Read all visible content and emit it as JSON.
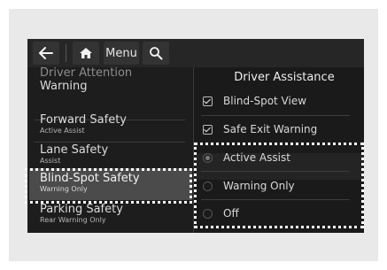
{
  "toolbar": {
    "menu_label": "Menu"
  },
  "left_menu": {
    "items": [
      {
        "title": "Driver Attention",
        "title2": "Warning",
        "subtitle": ""
      },
      {
        "title": "Forward Safety",
        "subtitle": "Active Assist"
      },
      {
        "title": "Lane Safety",
        "subtitle": "Assist"
      },
      {
        "title": "Blind-Spot Safety",
        "subtitle": "Warning Only"
      },
      {
        "title": "Parking Safety",
        "subtitle": "Rear Warning Only"
      }
    ]
  },
  "panel": {
    "title": "Driver Assistance",
    "checkboxes": [
      {
        "label": "Blind-Spot View",
        "checked": true
      },
      {
        "label": "Safe Exit Warning",
        "checked": true
      }
    ],
    "radio_options": [
      {
        "label": "Active Assist",
        "selected": true
      },
      {
        "label": "Warning Only",
        "selected": false
      },
      {
        "label": "Off",
        "selected": false
      }
    ]
  },
  "icons": [
    "back-arrow-icon",
    "home-icon",
    "search-icon"
  ],
  "colors": {
    "screen_bg": "#1a1a1a",
    "selected_item_bg": "#4b4b4b",
    "callout": "#ffffff"
  }
}
